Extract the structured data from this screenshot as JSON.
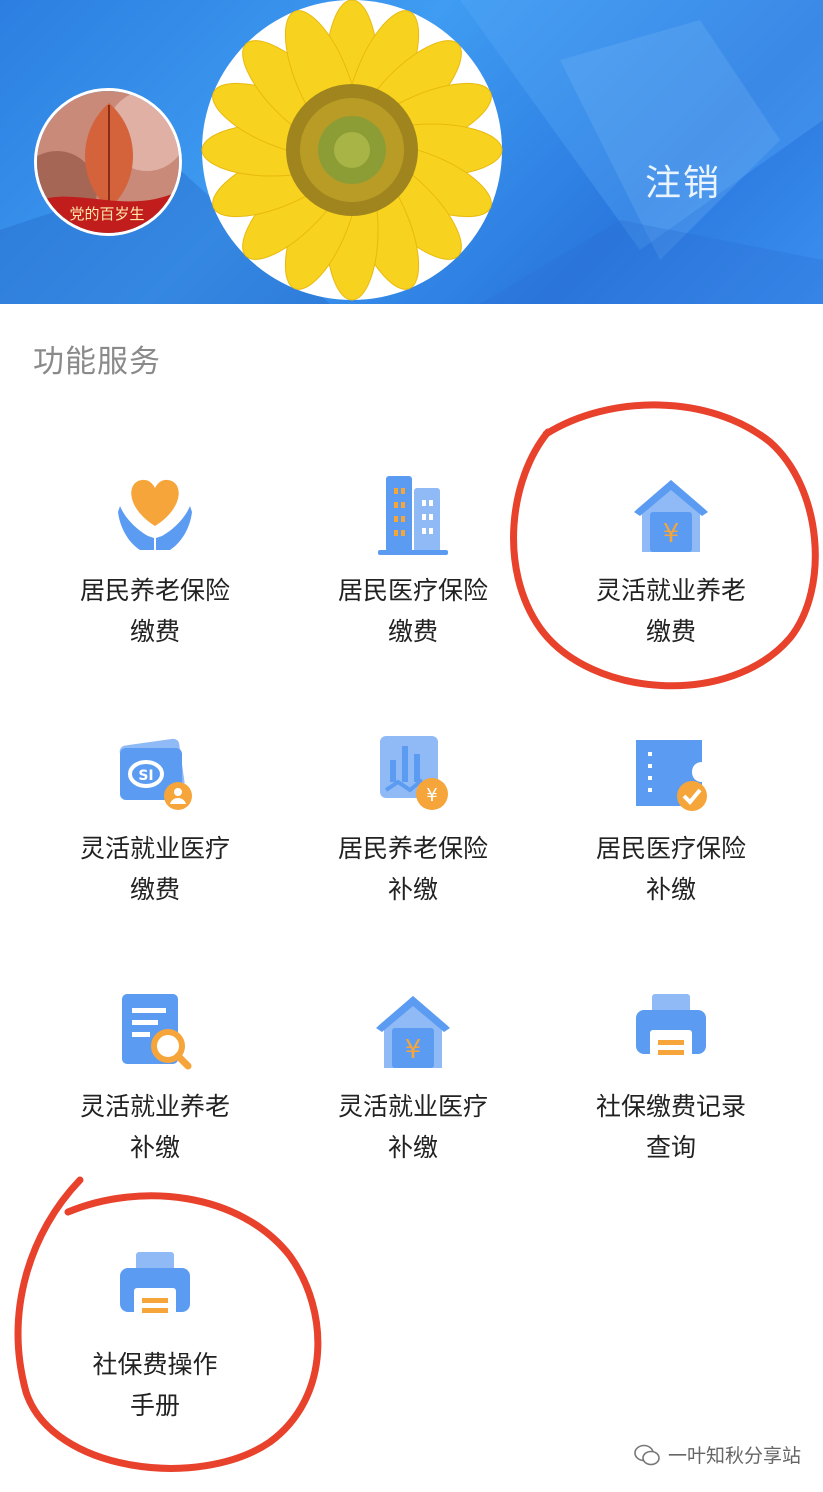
{
  "header": {
    "logout_label": "注销",
    "avatar_badge": "党的百岁生"
  },
  "services": {
    "title": "功能服务",
    "items": [
      {
        "line1": "居民养老保险",
        "line2": "缴费",
        "icon": "heart-hands-icon"
      },
      {
        "line1": "居民医疗保险",
        "line2": "缴费",
        "icon": "buildings-icon"
      },
      {
        "line1": "灵活就业养老",
        "line2": "缴费",
        "icon": "house-yen-icon"
      },
      {
        "line1": "灵活就业医疗",
        "line2": "缴费",
        "icon": "si-card-icon"
      },
      {
        "line1": "居民养老保险",
        "line2": "补缴",
        "icon": "chart-yen-icon"
      },
      {
        "line1": "居民医疗保险",
        "line2": "补缴",
        "icon": "ticket-check-icon"
      },
      {
        "line1": "灵活就业养老",
        "line2": "补缴",
        "icon": "document-search-icon"
      },
      {
        "line1": "灵活就业医疗",
        "line2": "补缴",
        "icon": "house-yen-icon"
      },
      {
        "line1": "社保缴费记录",
        "line2": "查询",
        "icon": "printer-icon"
      },
      {
        "line1": "社保费操作",
        "line2": "手册",
        "icon": "printer-icon"
      }
    ]
  },
  "watermark": "一叶知秋分享站",
  "colors": {
    "accent": "#3d8ef0",
    "icon_blue": "#5b9cf2",
    "icon_orange": "#f6a53a",
    "annotation_red": "#e8412c"
  }
}
